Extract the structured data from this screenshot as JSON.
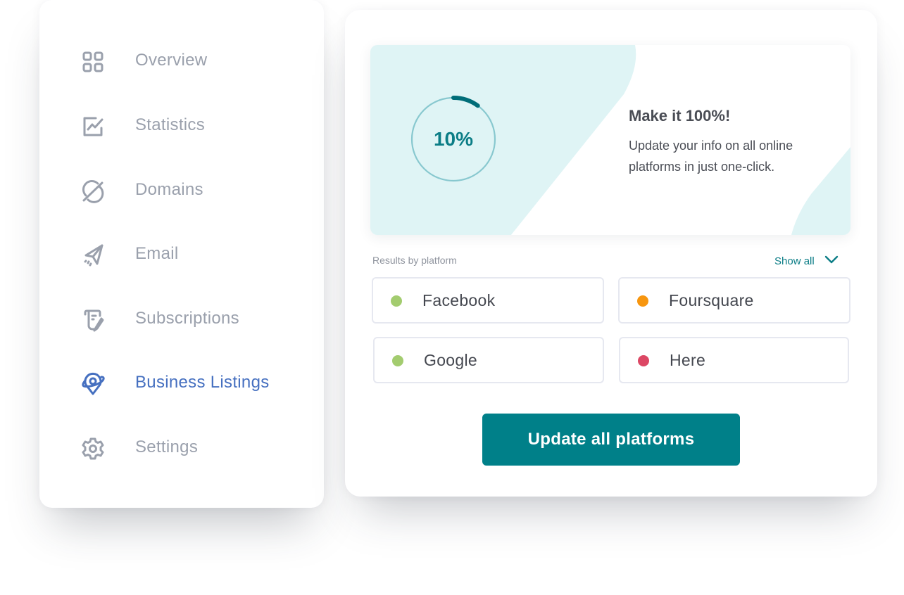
{
  "sidebar": {
    "items": [
      {
        "label": "Overview",
        "icon": "grid-icon",
        "active": false
      },
      {
        "label": "Statistics",
        "icon": "chart-icon",
        "active": false
      },
      {
        "label": "Domains",
        "icon": "planet-icon",
        "active": false
      },
      {
        "label": "Email",
        "icon": "paper-plane-icon",
        "active": false
      },
      {
        "label": "Subscriptions",
        "icon": "scroll-pen-icon",
        "active": false
      },
      {
        "label": "Business Listings",
        "icon": "location-pin-icon",
        "active": true
      },
      {
        "label": "Settings",
        "icon": "gear-icon",
        "active": false
      }
    ]
  },
  "promo": {
    "progress_value": 10,
    "progress_label": "10%",
    "title": "Make it 100%!",
    "text": "Update your info on all online platforms in just one-click."
  },
  "results": {
    "label": "Results by platform",
    "show_all_label": "Show all",
    "platforms": [
      {
        "name": "Facebook",
        "status_color": "#a3cc6f"
      },
      {
        "name": "Foursquare",
        "status_color": "#f7960f"
      },
      {
        "name": "Google",
        "status_color": "#a3cc6f"
      },
      {
        "name": "Here",
        "status_color": "#dc4764"
      }
    ]
  },
  "actions": {
    "update_all_label": "Update all platforms"
  },
  "colors": {
    "accent": "#008089",
    "accent_text": "#0b7d86",
    "active_nav": "#4670c0",
    "inactive_nav": "#9aa0ac",
    "promo_bg": "#dff4f5"
  }
}
